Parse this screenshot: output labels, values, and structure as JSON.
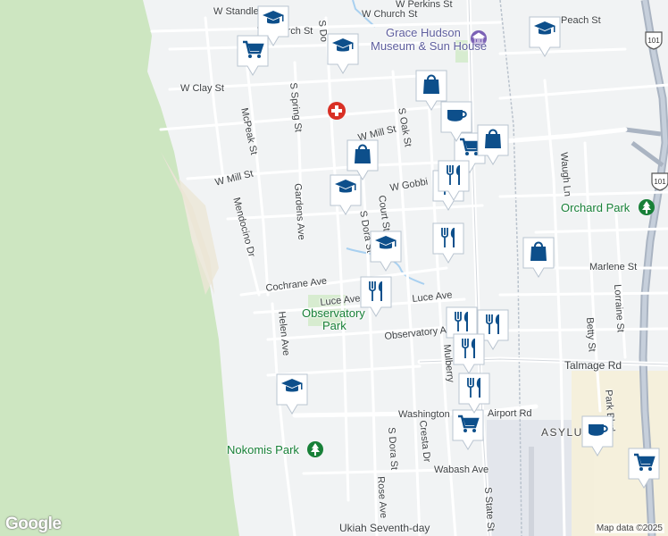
{
  "map": {
    "attribution": "Map data ©2025",
    "logo": "Google",
    "highway_shield": "101",
    "streets": [
      {
        "id": "w-standley",
        "text": "W Standley St"
      },
      {
        "id": "w-perkins",
        "text": "W Perkins St"
      },
      {
        "id": "w-church",
        "text": "W Church St"
      },
      {
        "id": "w-church-2",
        "text": "W Church St"
      },
      {
        "id": "peach",
        "text": "Peach St"
      },
      {
        "id": "w-clay",
        "text": "W Clay St"
      },
      {
        "id": "w-mill",
        "text": "W Mill St"
      },
      {
        "id": "w-mill-2",
        "text": "W Mill St"
      },
      {
        "id": "mcpeak",
        "text": "McPeak St"
      },
      {
        "id": "s-spring",
        "text": "S Spring St"
      },
      {
        "id": "s-oak",
        "text": "S Oak St"
      },
      {
        "id": "w-gobbi",
        "text": "W Gobbi"
      },
      {
        "id": "court",
        "text": "Court St"
      },
      {
        "id": "s-dora",
        "text": "S Dora St"
      },
      {
        "id": "s-dora-2",
        "text": "S Dora St"
      },
      {
        "id": "mendocino",
        "text": "Mendocino Dr"
      },
      {
        "id": "gardens",
        "text": "Gardens Ave"
      },
      {
        "id": "cochrane",
        "text": "Cochrane Ave"
      },
      {
        "id": "luce",
        "text": "Luce Ave"
      },
      {
        "id": "luce-2",
        "text": "Luce Ave"
      },
      {
        "id": "helen",
        "text": "Helen Ave"
      },
      {
        "id": "observatory",
        "text": "Observatory Ave"
      },
      {
        "id": "talmage",
        "text": "Talmage Rd"
      },
      {
        "id": "marlene",
        "text": "Marlene St"
      },
      {
        "id": "waugh",
        "text": "Waugh Ln"
      },
      {
        "id": "lorraine",
        "text": "Lorraine St"
      },
      {
        "id": "betty",
        "text": "Betty St"
      },
      {
        "id": "park-blvd",
        "text": "Park Blvd"
      },
      {
        "id": "washington",
        "text": "Washington"
      },
      {
        "id": "airport",
        "text": "Airport Rd"
      },
      {
        "id": "cresta",
        "text": "Cresta Dr"
      },
      {
        "id": "wabash",
        "text": "Wabash Ave"
      },
      {
        "id": "rose",
        "text": "Rose Ave"
      },
      {
        "id": "s-state",
        "text": "S State St"
      },
      {
        "id": "mulberry",
        "text": "Mulberry"
      },
      {
        "id": "s-dora-3",
        "text": "S Dora St"
      },
      {
        "id": "s-state-top",
        "text": "S State"
      },
      {
        "id": "s-do",
        "text": "S Do"
      }
    ],
    "places": {
      "museum_line1": "Grace Hudson",
      "museum_line2": "Museum & Sun House",
      "observatory_park_line1": "Observatory",
      "observatory_park_line2": "Park",
      "nokomis_park": "Nokomis Park",
      "orchard_park": "Orchard Park",
      "ukiah_sda": "Ukiah Seventh-day",
      "asylum": "ASYLU"
    },
    "markers": [
      {
        "type": "school",
        "icon": "school-icon"
      },
      {
        "type": "school",
        "icon": "school-icon"
      },
      {
        "type": "school",
        "icon": "school-icon"
      },
      {
        "type": "school",
        "icon": "school-icon"
      },
      {
        "type": "school",
        "icon": "school-icon"
      },
      {
        "type": "school",
        "icon": "school-icon"
      },
      {
        "type": "grocery",
        "icon": "shopping-cart-icon"
      },
      {
        "type": "grocery",
        "icon": "shopping-cart-icon"
      },
      {
        "type": "grocery",
        "icon": "shopping-cart-icon"
      },
      {
        "type": "grocery",
        "icon": "shopping-cart-icon"
      },
      {
        "type": "shopping",
        "icon": "shopping-bag-icon"
      },
      {
        "type": "shopping",
        "icon": "shopping-bag-icon"
      },
      {
        "type": "shopping",
        "icon": "shopping-bag-icon"
      },
      {
        "type": "shopping",
        "icon": "shopping-bag-icon"
      },
      {
        "type": "cafe",
        "icon": "coffee-cup-icon"
      },
      {
        "type": "cafe",
        "icon": "coffee-cup-icon"
      },
      {
        "type": "restaurant",
        "icon": "fork-knife-icon"
      },
      {
        "type": "restaurant",
        "icon": "fork-knife-icon"
      },
      {
        "type": "restaurant",
        "icon": "fork-knife-icon"
      },
      {
        "type": "restaurant",
        "icon": "fork-knife-icon"
      },
      {
        "type": "restaurant",
        "icon": "fork-knife-icon"
      },
      {
        "type": "restaurant",
        "icon": "fork-knife-icon"
      },
      {
        "type": "restaurant",
        "icon": "fork-knife-icon"
      },
      {
        "type": "restaurant",
        "icon": "fork-knife-icon"
      }
    ],
    "colors": {
      "marker_blue": "#0d4f8b",
      "marker_bg": "#ffffff",
      "park_green": "#188038",
      "forest": "#cfe8c4",
      "hospital_red": "#d93025",
      "highway": "#9aa6b4",
      "water": "#a8d0f0"
    }
  }
}
